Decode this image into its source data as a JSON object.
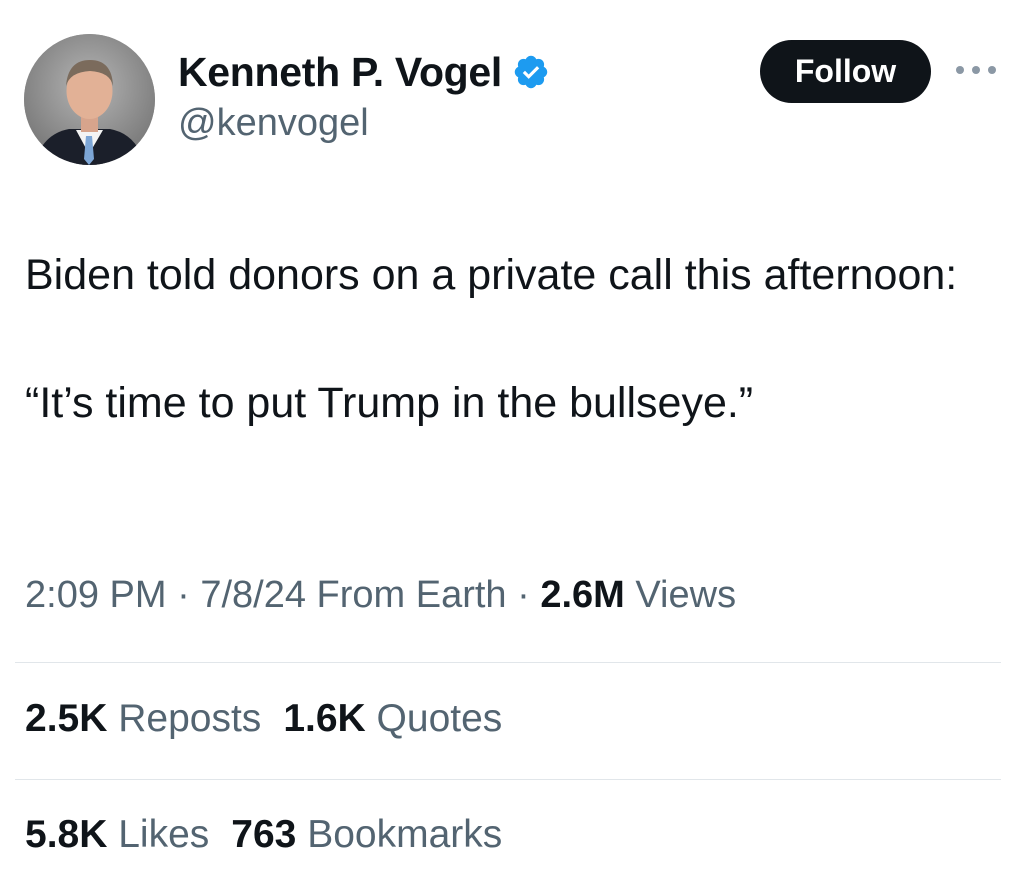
{
  "author": {
    "display_name": "Kenneth P. Vogel",
    "handle": "@kenvogel",
    "verified_icon": "verified-badge-icon",
    "verified_color": "#1d9bf0"
  },
  "follow_label": "Follow",
  "more_icon": "more-horizontal-icon",
  "tweet": {
    "line1": "Biden told donors on a private call this afternoon:",
    "line2": "“It’s time to put Trump in the bullseye.”"
  },
  "meta": {
    "time": "2:09 PM",
    "sep1": " · ",
    "date_location": "7/8/24 From Earth",
    "sep2": " · ",
    "views_count": "2.6M",
    "views_label": " Views"
  },
  "stats": {
    "reposts": {
      "count": "2.5K",
      "label": "Reposts"
    },
    "quotes": {
      "count": "1.6K",
      "label": "Quotes"
    },
    "likes": {
      "count": "5.8K",
      "label": "Likes"
    },
    "bookmarks": {
      "count": "763",
      "label": "Bookmarks"
    }
  },
  "colors": {
    "text_primary": "#0f1419",
    "text_secondary": "#536471",
    "button_bg": "#0f1419",
    "divider": "#e1e6ea"
  }
}
